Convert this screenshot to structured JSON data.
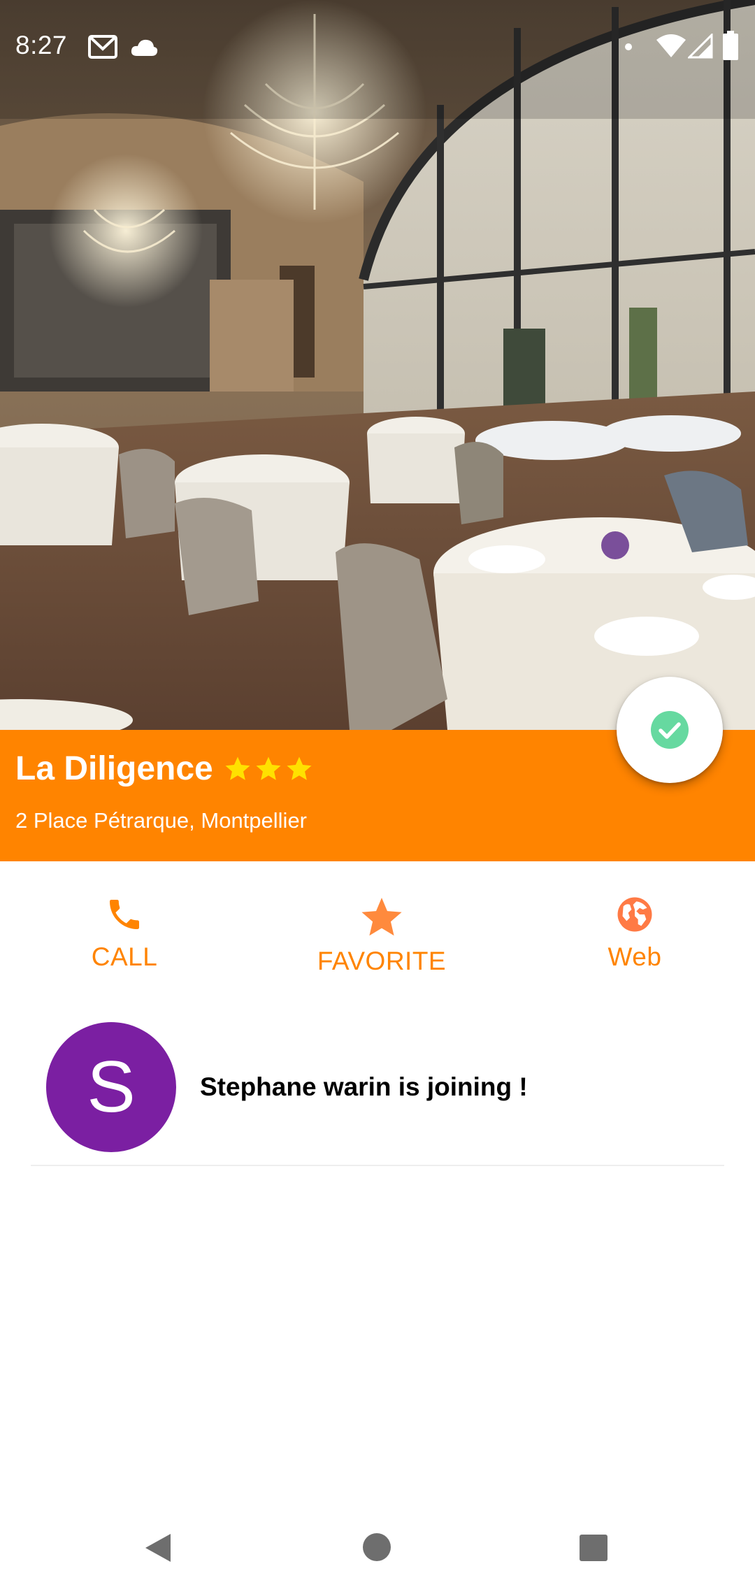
{
  "status_bar": {
    "time": "8:27",
    "icons": [
      "gmail-icon",
      "cloud-icon",
      "notification-dot-icon",
      "wifi-icon",
      "signal-icon",
      "battery-icon"
    ]
  },
  "hero": {
    "image": "restaurant-dining-room-photo"
  },
  "restaurant": {
    "name": "La Diligence",
    "rating": 3,
    "address": "2 Place Pétrarque, Montpellier"
  },
  "fab": {
    "icon": "check-circle-icon"
  },
  "actions": {
    "call": {
      "label": "CALL",
      "icon": "phone-icon"
    },
    "favorite": {
      "label": "FAVORITE",
      "icon": "star-icon"
    },
    "web": {
      "label": "Web",
      "icon": "globe-icon"
    }
  },
  "participant": {
    "initial": "S",
    "message": "Stephane warin is joining !"
  },
  "nav": {
    "icons": [
      "back-icon",
      "home-icon",
      "recents-icon"
    ]
  },
  "colors": {
    "accent": "#ff8400",
    "star_rating": "#ffe100",
    "favorite_star": "#ff8a3d",
    "check": "#66d9a0",
    "avatar": "#7b1fa2"
  }
}
